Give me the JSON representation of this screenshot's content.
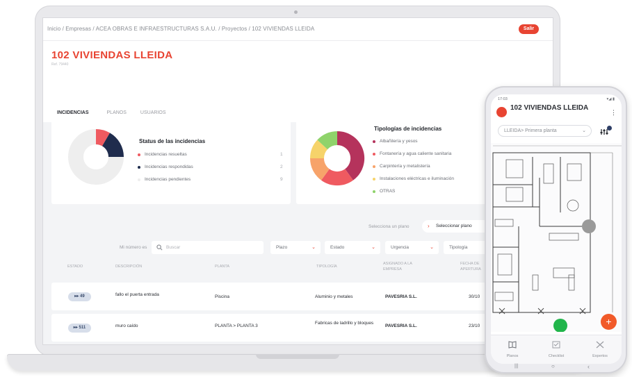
{
  "app": {
    "breadcrumb": "Inicio / Empresas / ACEA OBRAS E INFRAESTRUCTURAS S.A.U. / Proyectos / 102 VIVIENDAS LLEIDA",
    "exit_label": "Salir",
    "project_title": "102 VIVIENDAS LLEIDA",
    "project_subtitle": "Ref. 79440",
    "tabs": [
      {
        "label": "INCIDENCIAS",
        "active": true
      },
      {
        "label": "PLANOS",
        "active": false
      },
      {
        "label": "USUARIOS",
        "active": false
      }
    ]
  },
  "status_card": {
    "title": "Status de las incidencias",
    "items": [
      {
        "label": "Incidencias resueltas",
        "count": "1",
        "color": "#ef5a60"
      },
      {
        "label": "Incidencias respondidas",
        "count": "2",
        "color": "#1f2c4d"
      },
      {
        "label": "Incidencias pendientes",
        "count": "9",
        "color": "#eeeeee"
      }
    ]
  },
  "typology_card": {
    "title": "Tipologías de incidencias",
    "items": [
      {
        "label": "Albañilería y yesos",
        "color": "#b5335c"
      },
      {
        "label": "Fontanería y agua caliente sanitaria",
        "color": "#ef5a60"
      },
      {
        "label": "Carpintería y metalistería",
        "color": "#f7a36a"
      },
      {
        "label": "Instalaciones eléctricas e iluminación",
        "color": "#f6d36a"
      },
      {
        "label": "OTRAS",
        "color": "#8fd36b"
      }
    ]
  },
  "filters": {
    "plan_label": "Selecciona un plano",
    "plan_placeholder": "Seleccionar plano",
    "search_label": "Mi número es",
    "search_placeholder": "Buscar",
    "selects": [
      "Plazo",
      "Estado",
      "Urgencia",
      "Tipología"
    ]
  },
  "table": {
    "headers": [
      "Estado",
      "Descripción",
      "Planta",
      "Tipología",
      "Asignado a la empresa",
      "Fecha de apertura"
    ],
    "rows": [
      {
        "id": "49",
        "description": "fallo el puerta entrada",
        "floor": "Piscina",
        "typology": "Aluminio y metales",
        "company": "PAVESRIA S.L.",
        "date": "30/10"
      },
      {
        "id": "511",
        "description": "muro caído",
        "floor": "PLANTA > PLANTA 3",
        "typology": "Fabricas de ladrillo y bloques",
        "company": "PAVESRIA S.L.",
        "date": "23/10"
      }
    ]
  },
  "phone": {
    "status_time": "17:03",
    "status_right": "▾◢ ▮",
    "title": "102 VIVIENDAS LLEIDA",
    "plan_select": "LLEIDA> Primera planta",
    "fab_label": "+",
    "nav": [
      {
        "label": "Planos",
        "icon": "book-icon"
      },
      {
        "label": "Checklist",
        "icon": "checklist-icon"
      },
      {
        "label": "Expertos",
        "icon": "expert-icon"
      }
    ],
    "android_nav": [
      "|||",
      "○",
      "‹"
    ]
  }
}
